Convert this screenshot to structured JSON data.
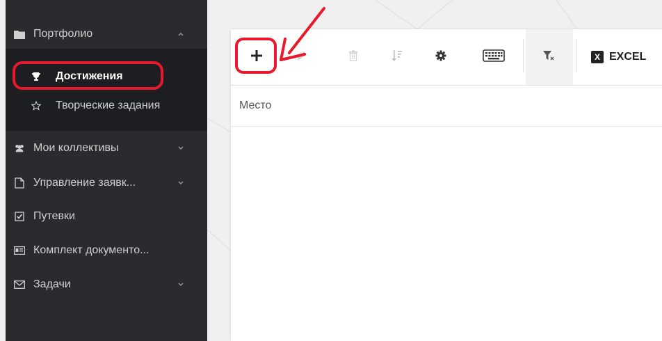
{
  "sidebar": {
    "items": [
      {
        "label": "Портфолио",
        "icon": "folder-icon"
      },
      {
        "label": "Мои коллективы",
        "icon": "users-icon"
      },
      {
        "label": "Управление заявк...",
        "icon": "document-icon"
      },
      {
        "label": "Путевки",
        "icon": "checkbox-icon"
      },
      {
        "label": "Комплект документо...",
        "icon": "id-card-icon"
      },
      {
        "label": "Задачи",
        "icon": "envelope-icon"
      }
    ],
    "submenu": [
      {
        "label": "Достижения",
        "icon": "trophy-icon"
      },
      {
        "label": "Творческие задания",
        "icon": "star-icon"
      }
    ]
  },
  "toolbar": {
    "buttons": [
      "add-icon",
      "edit-icon",
      "delete-icon",
      "sort-icon",
      "gear-icon",
      "keyboard-icon",
      "filter-clear-icon"
    ],
    "excel_badge": "X",
    "excel_label": "EXCEL"
  },
  "table": {
    "columns": [
      "Место"
    ]
  },
  "colors": {
    "sidebar_bg": "#2a2b2e",
    "submenu_bg": "#1d1e21",
    "annotation_red": "#e8192c"
  }
}
